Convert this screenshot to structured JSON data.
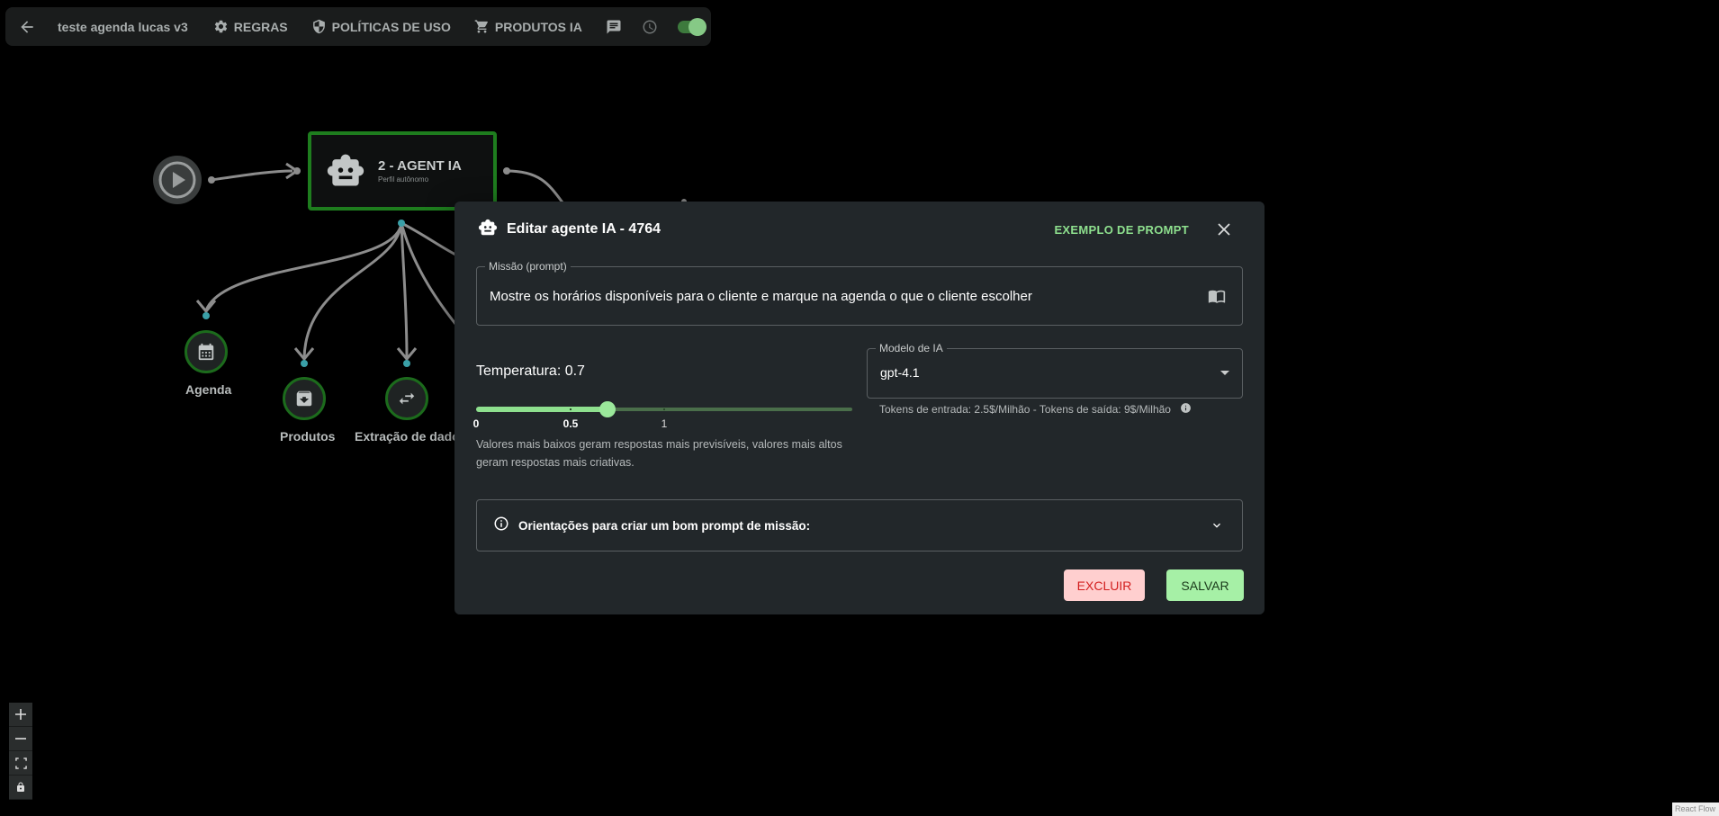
{
  "toolbar": {
    "title": "teste agenda lucas v3",
    "rules_label": "REGRAS",
    "policies_label": "POLÍTICAS DE USO",
    "products_label": "PRODUTOS IA",
    "toggle_on": true
  },
  "flow": {
    "agent_node": {
      "title": "2 - AGENT IA",
      "subtitle": "Perfil autônomo"
    },
    "tool_nodes": [
      {
        "label": "Agenda",
        "icon": "calendar-icon"
      },
      {
        "label": "Produtos",
        "icon": "archive-icon"
      },
      {
        "label": "Extração de dados",
        "icon": "swap-icon"
      }
    ]
  },
  "zoom_controls": [
    "zoom-in",
    "zoom-out",
    "fit-view",
    "lock"
  ],
  "attribution": "React Flow",
  "modal": {
    "title": "Editar agente IA - 4764",
    "example_prompt_label": "EXEMPLO DE PROMPT",
    "mission": {
      "label": "Missão (prompt)",
      "value": "Mostre os horários disponíveis para o cliente e marque na agenda o que o cliente escolher"
    },
    "temperature": {
      "label": "Temperatura: 0.7",
      "value": 0.7,
      "min": 0,
      "max": 2,
      "marks": [
        "0",
        "0.5",
        "1"
      ],
      "help": "Valores mais baixos geram respostas mais previsíveis, valores mais altos geram respostas mais criativas."
    },
    "model": {
      "label": "Modelo de IA",
      "value": "gpt-4.1",
      "tokens_info": "Tokens de entrada: 2.5$/Milhão - Tokens de saída: 9$/Milhão"
    },
    "guide_label": "Orientações para criar um bom prompt de missão:",
    "delete_label": "EXCLUIR",
    "save_label": "SALVAR"
  },
  "colors": {
    "accent_green": "#8ee08e",
    "node_border": "#1e7d1e",
    "delete_bg": "#ffcfcf",
    "delete_text": "#d32020",
    "save_bg": "#a6f0a6",
    "modal_bg": "#22272a"
  }
}
